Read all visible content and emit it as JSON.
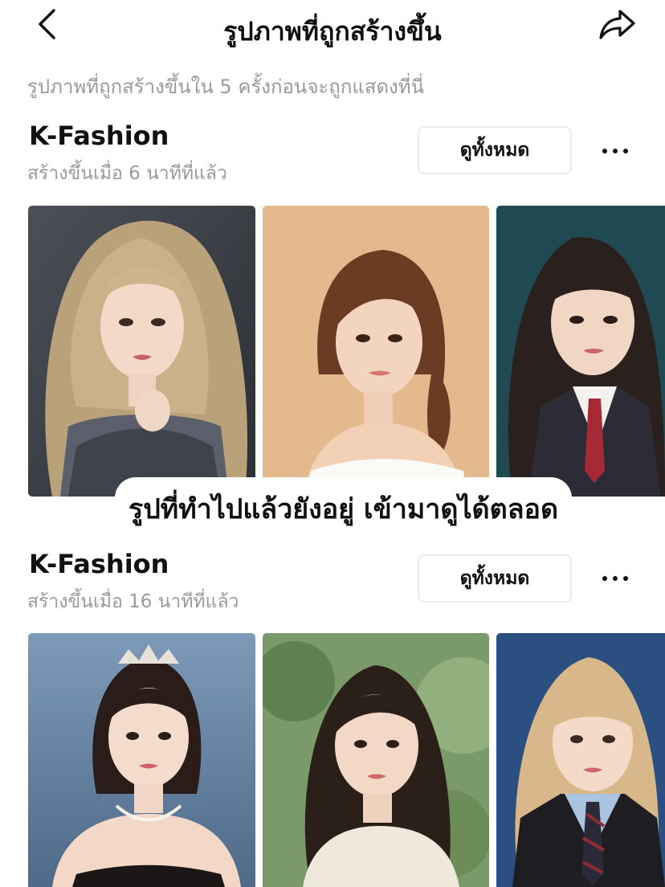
{
  "header": {
    "title": "รูปภาพที่ถูกสร้างขึ้น",
    "back_icon": "chevron-left-icon",
    "share_icon": "share-arrow-icon"
  },
  "subtitle": "รูปภาพที่ถูกสร้างขึ้นใน 5 ครั้งก่อนจะถูกแสดงที่นี่",
  "groups": [
    {
      "title": "K-Fashion",
      "time": "สร้างขึ้นเมื่อ 6 นาทีที่แล้ว",
      "view_all": "ดูทั้งหมด",
      "more_icon": "more-dots-icon",
      "images": [
        "portrait-blonde-fur",
        "portrait-brown-ponytail",
        "portrait-bangs-uniform"
      ]
    },
    {
      "title": "K-Fashion",
      "time": "สร้างขึ้นเมื่อ 16 นาทีที่แล้ว",
      "view_all": "ดูทั้งหมด",
      "more_icon": "more-dots-icon",
      "images": [
        "portrait-tiara-updo",
        "portrait-long-dark-hair",
        "portrait-blonde-bangs-uniform"
      ]
    }
  ],
  "overlay_caption": "รูปที่ทำไปแล้วยังอยู่ เข้ามาดูได้ตลอด",
  "colors": {
    "text_primary": "#111111",
    "text_secondary": "#9a9a9a",
    "button_border": "#ececec",
    "background": "#ffffff"
  }
}
